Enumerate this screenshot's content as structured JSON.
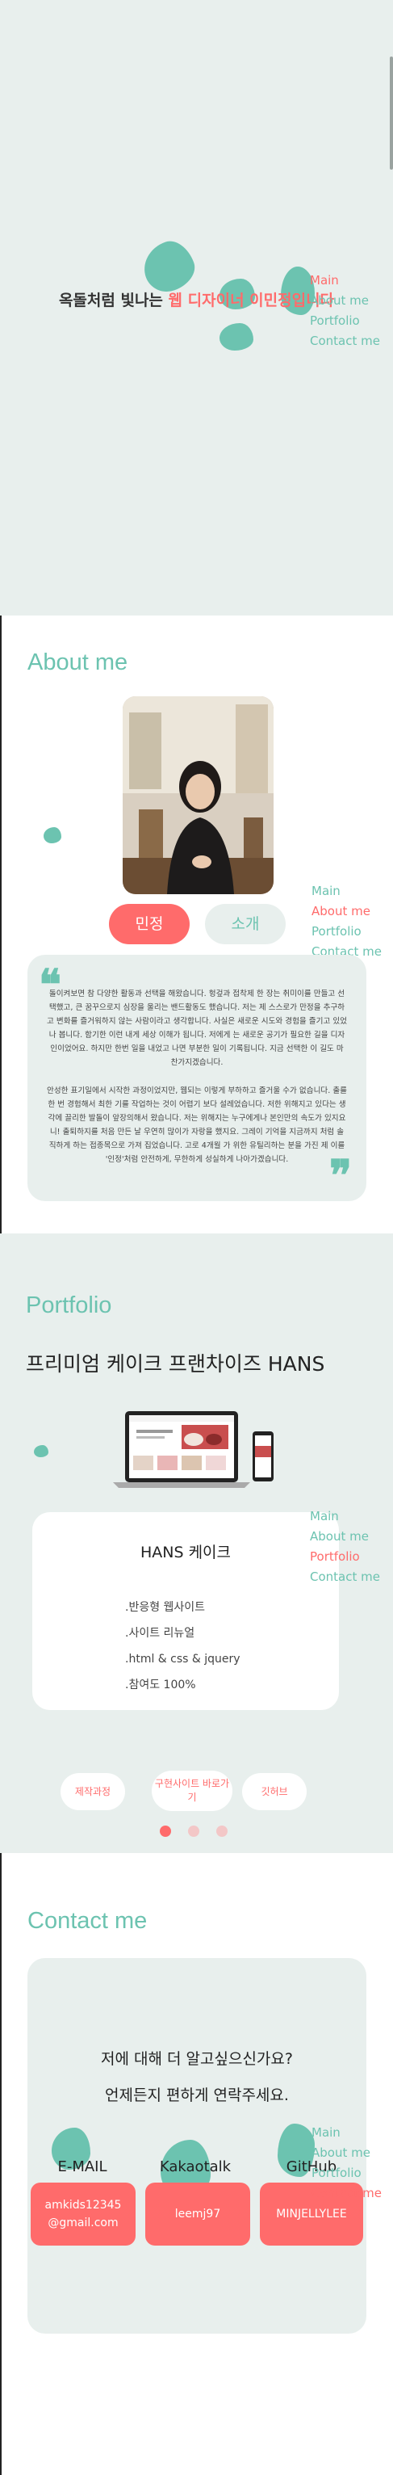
{
  "nav": {
    "items": [
      "Main",
      "About me",
      "Portfolio",
      "Contact me"
    ]
  },
  "hero": {
    "title_prefix": "옥돌처럼 빛나는 ",
    "title_highlight": "웹 디자이너 이민정입니다"
  },
  "about": {
    "title": "About me",
    "tab_active": "민정",
    "tab_inactive": "소개",
    "quote_open": "❝",
    "quote_close": "❞",
    "paragraph1": "돌이켜보면 참 다양한 활동과 선택을 해왔습니다. 헝겊과 접착제 한 장는 취미이를 만들고 선택했고, 큰 꿈꾸으로지 심장을 울리는 밴드활동도 했습니다. 저는 제 스스로가 만정을 추구하고 변화를 즐거워하지 않는 사람이라고 생각합니다. 사실은 새로운 시도와 경험을 즐기고 있었나 봅니다. 함기한 이런 내게 세상 이해가 됩니다. 저에게 는 새로운 공기가 필요한 길을 디자인이었어요. 하지만 한번 일을 내었고 나면 부분한 일이 기록됩니다. 지금 선택한 이 길도 마찬가지겠습니다.",
    "paragraph2": "안성한 표기일에서 시작한 과정이었지만, 웹되는 이렇게 부하하고 즐거울 수가 없습니다. 출를 한 번 경험해서 최한 기를 작업하는 것이 어렵기 보다 설레었습니다. 저한 위해지고 있다는 생각에 끌리한 발돌이 앞장의해서 왔습니다. 저는 위해지는 누구에게나 본인만의 속도가 있지요니! 출퇴하지를 처음 만든 날 우연히 많이가 자랑을 했지요. 그레이 기억을 지금까지 처럼 솔직하게 하는 접종목으로 가져 집었습니다. 고로 4개월 가 위한 유틸리하는 분을 가진 제 이를 '인정'처럼 안전하게, 무한하게 성실하게 나아가겠습니다."
  },
  "portfolio": {
    "title": "Portfolio",
    "project_title": "프리미엄 케이크 프랜차이즈 HANS",
    "card_title": "HANS 케이크",
    "details": [
      ".반응형 웹사이트",
      ".사이트 리뉴얼",
      ".html & css & jquery",
      ".참여도 100%"
    ],
    "buttons": [
      "제작과정",
      "구현사이트 바로가기",
      "깃허브"
    ],
    "pagination_active": 1,
    "pagination_total": 3
  },
  "contact": {
    "title": "Contact me",
    "line1": "저에 대해 더 알고싶으신가요?",
    "line2": "언제든지 편하게 연락주세요.",
    "columns": [
      {
        "label": "E-MAIL",
        "value_line1": "amkids12345",
        "value_line2": "@gmail.com"
      },
      {
        "label": "Kakaotalk",
        "value_line1": "leemj97",
        "value_line2": ""
      },
      {
        "label": "GitHub",
        "value_line1": "MINJELLYLEE",
        "value_line2": ""
      }
    ]
  },
  "colors": {
    "accent_green": "#6cc3b0",
    "accent_red": "#ff6b6b",
    "background_mint": "#e8efed"
  }
}
